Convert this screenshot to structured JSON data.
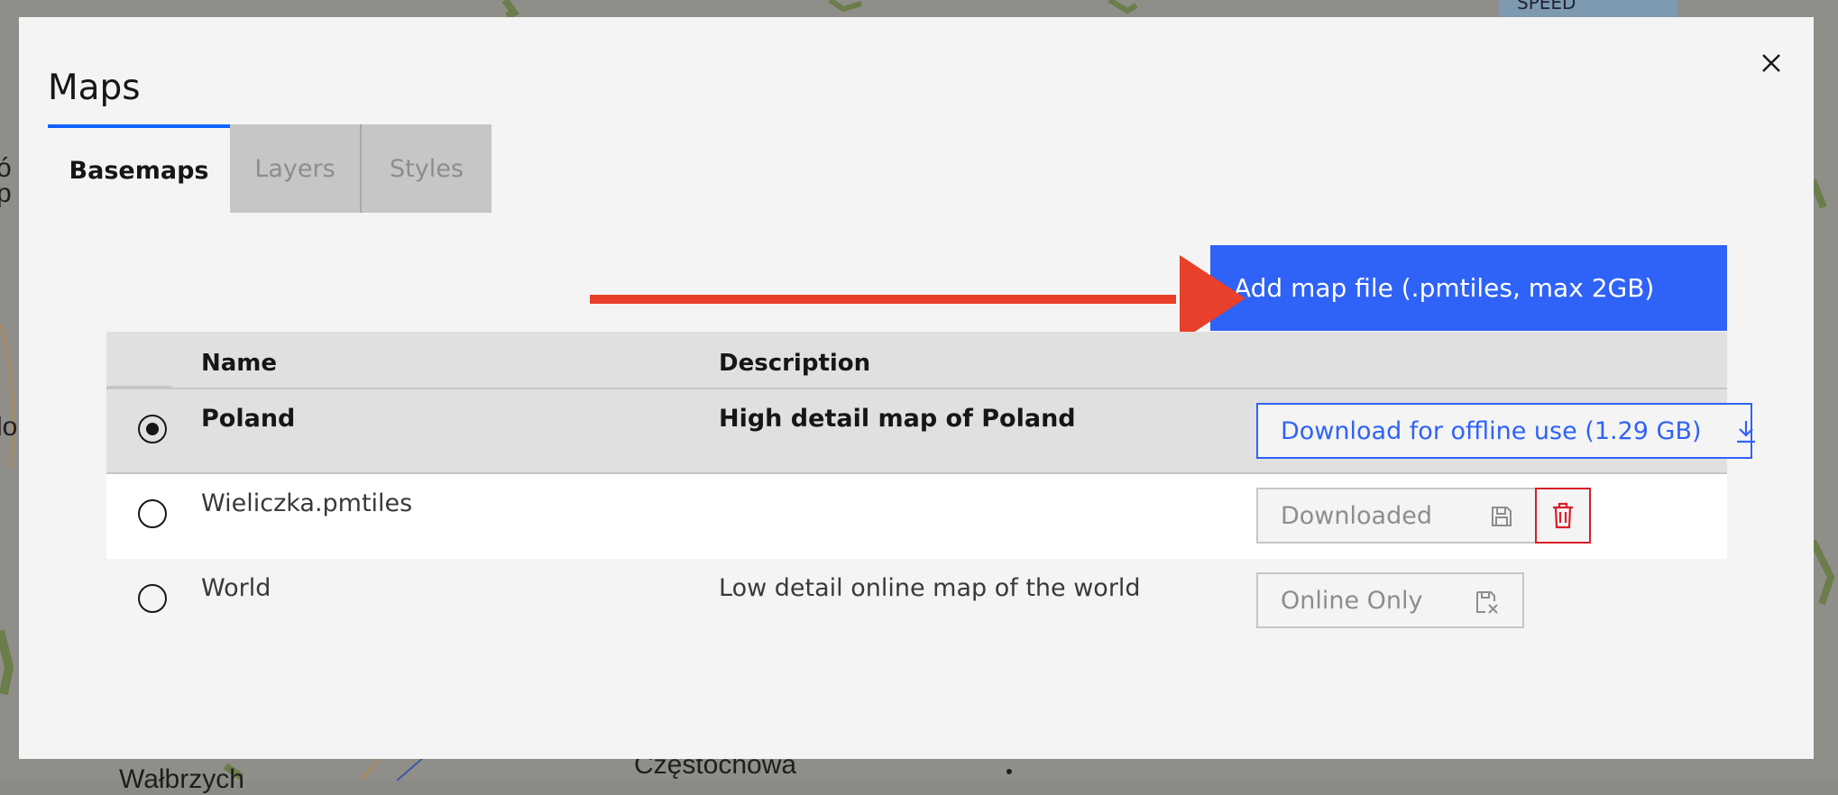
{
  "background_map": {
    "labels": [
      "Wałbrzych",
      "Częstochowa"
    ],
    "speed_badge": "SPEED"
  },
  "modal": {
    "title": "Maps",
    "close_icon": "close-icon",
    "tabs": [
      {
        "label": "Basemaps",
        "active": true
      },
      {
        "label": "Layers",
        "active": false
      },
      {
        "label": "Styles",
        "active": false
      }
    ],
    "add_button_label": "Add map file (.pmtiles, max 2GB)",
    "table": {
      "headers": {
        "name": "Name",
        "description": "Description"
      },
      "rows": [
        {
          "selected": true,
          "name": "Poland",
          "description": "High detail map of Poland",
          "action_label": "Download for offline use (1.29 GB)",
          "action_icon": "download-icon"
        },
        {
          "selected": false,
          "name": "Wieliczka.pmtiles",
          "description": "",
          "action_label": "Downloaded",
          "action_icon": "save-icon",
          "delete_icon": "trash-icon"
        },
        {
          "selected": false,
          "name": "World",
          "description": "Low detail online map of the world",
          "action_label": "Online Only",
          "action_icon": "save-off-icon"
        }
      ]
    }
  },
  "colors": {
    "primary": "#2f62f7",
    "danger": "#da1e28",
    "annotation_arrow": "#e8402a"
  }
}
